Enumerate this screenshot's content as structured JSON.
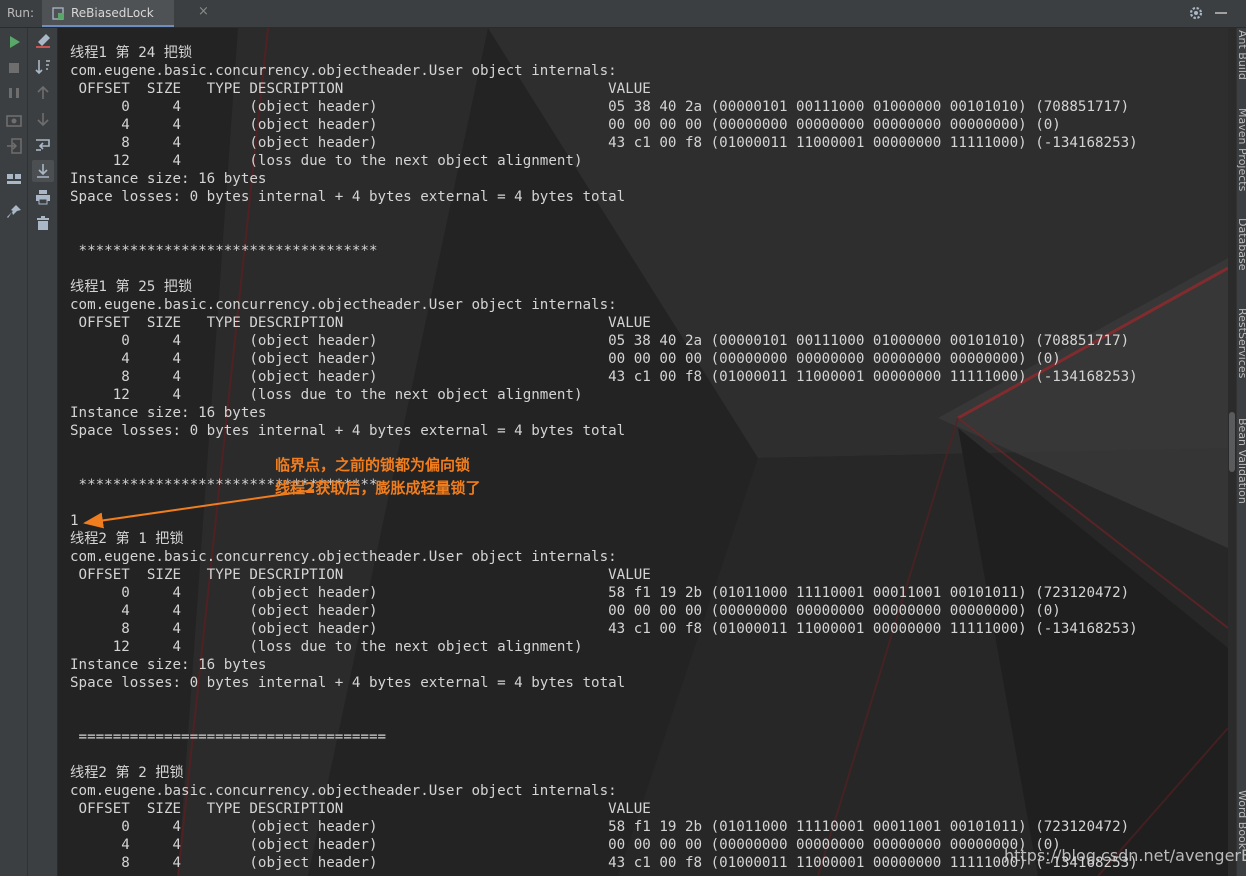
{
  "header": {
    "run_label": "Run:",
    "tab_title": "ReBiasedLock",
    "tab_close": "×"
  },
  "toolbar_left": [
    {
      "name": "rerun-icon",
      "color": "#59a869"
    },
    {
      "name": "stop-icon",
      "color": "#6e6e6e"
    },
    {
      "name": "pause-icon",
      "color": "#6e6e6e"
    },
    {
      "name": "camera-icon",
      "color": "#6e6e6e"
    },
    {
      "name": "exit-icon",
      "color": "#6e6e6e"
    },
    {
      "name": "layout-icon",
      "color": "#a9b7c6"
    },
    {
      "name": "pin-icon",
      "color": "#a9b7c6"
    }
  ],
  "toolbar_right": [
    {
      "name": "clear-icon",
      "color": "#c75450"
    },
    {
      "name": "sort-icon",
      "color": "#a9b7c6"
    },
    {
      "name": "up-icon",
      "color": "#6e6e6e"
    },
    {
      "name": "down-icon",
      "color": "#6e6e6e"
    },
    {
      "name": "wrap-icon",
      "color": "#a9b7c6"
    },
    {
      "name": "scroll-end-icon",
      "color": "#a9b7c6"
    },
    {
      "name": "print-icon",
      "color": "#a9b7c6"
    },
    {
      "name": "trash-icon",
      "color": "#a9b7c6"
    }
  ],
  "console": {
    "lines": [
      "线程1 第 24 把锁",
      "com.eugene.basic.concurrency.objectheader.User object internals:",
      " OFFSET  SIZE   TYPE DESCRIPTION                               VALUE",
      "      0     4        (object header)                           05 38 40 2a (00000101 00111000 01000000 00101010) (708851717)",
      "      4     4        (object header)                           00 00 00 00 (00000000 00000000 00000000 00000000) (0)",
      "      8     4        (object header)                           43 c1 00 f8 (01000011 11000001 00000000 11111000) (-134168253)",
      "     12     4        (loss due to the next object alignment)",
      "Instance size: 16 bytes",
      "Space losses: 0 bytes internal + 4 bytes external = 4 bytes total",
      "",
      "",
      " ***********************************",
      "",
      "线程1 第 25 把锁",
      "com.eugene.basic.concurrency.objectheader.User object internals:",
      " OFFSET  SIZE   TYPE DESCRIPTION                               VALUE",
      "      0     4        (object header)                           05 38 40 2a (00000101 00111000 01000000 00101010) (708851717)",
      "      4     4        (object header)                           00 00 00 00 (00000000 00000000 00000000 00000000) (0)",
      "      8     4        (object header)                           43 c1 00 f8 (01000011 11000001 00000000 11111000) (-134168253)",
      "     12     4        (loss due to the next object alignment)",
      "Instance size: 16 bytes",
      "Space losses: 0 bytes internal + 4 bytes external = 4 bytes total",
      "",
      "",
      " ***********************************",
      "",
      "1",
      "线程2 第 1 把锁",
      "com.eugene.basic.concurrency.objectheader.User object internals:",
      " OFFSET  SIZE   TYPE DESCRIPTION                               VALUE",
      "      0     4        (object header)                           58 f1 19 2b (01011000 11110001 00011001 00101011) (723120472)",
      "      4     4        (object header)                           00 00 00 00 (00000000 00000000 00000000 00000000) (0)",
      "      8     4        (object header)                           43 c1 00 f8 (01000011 11000001 00000000 11111000) (-134168253)",
      "     12     4        (loss due to the next object alignment)",
      "Instance size: 16 bytes",
      "Space losses: 0 bytes internal + 4 bytes external = 4 bytes total",
      "",
      "",
      " ====================================",
      "",
      "线程2 第 2 把锁",
      "com.eugene.basic.concurrency.objectheader.User object internals:",
      " OFFSET  SIZE   TYPE DESCRIPTION                               VALUE",
      "      0     4        (object header)                           58 f1 19 2b (01011000 11110001 00011001 00101011) (723120472)",
      "      4     4        (object header)                           00 00 00 00 (00000000 00000000 00000000 00000000) (0)",
      "      8     4        (object header)                           43 c1 00 f8 (01000011 11000001 00000000 11111000) (-134168253)"
    ]
  },
  "annotation": {
    "line1": "临界点，之前的锁都为偏向锁",
    "line2": "线程2获取后，膨胀成轻量锁了",
    "color": "#f07d1e"
  },
  "right_sidebar": [
    "Ant Build",
    "Maven Projects",
    "Database",
    "RestServices",
    "Bean Validation",
    "Word Book"
  ],
  "watermark": "https://blog.csdn.net/avengerEug"
}
